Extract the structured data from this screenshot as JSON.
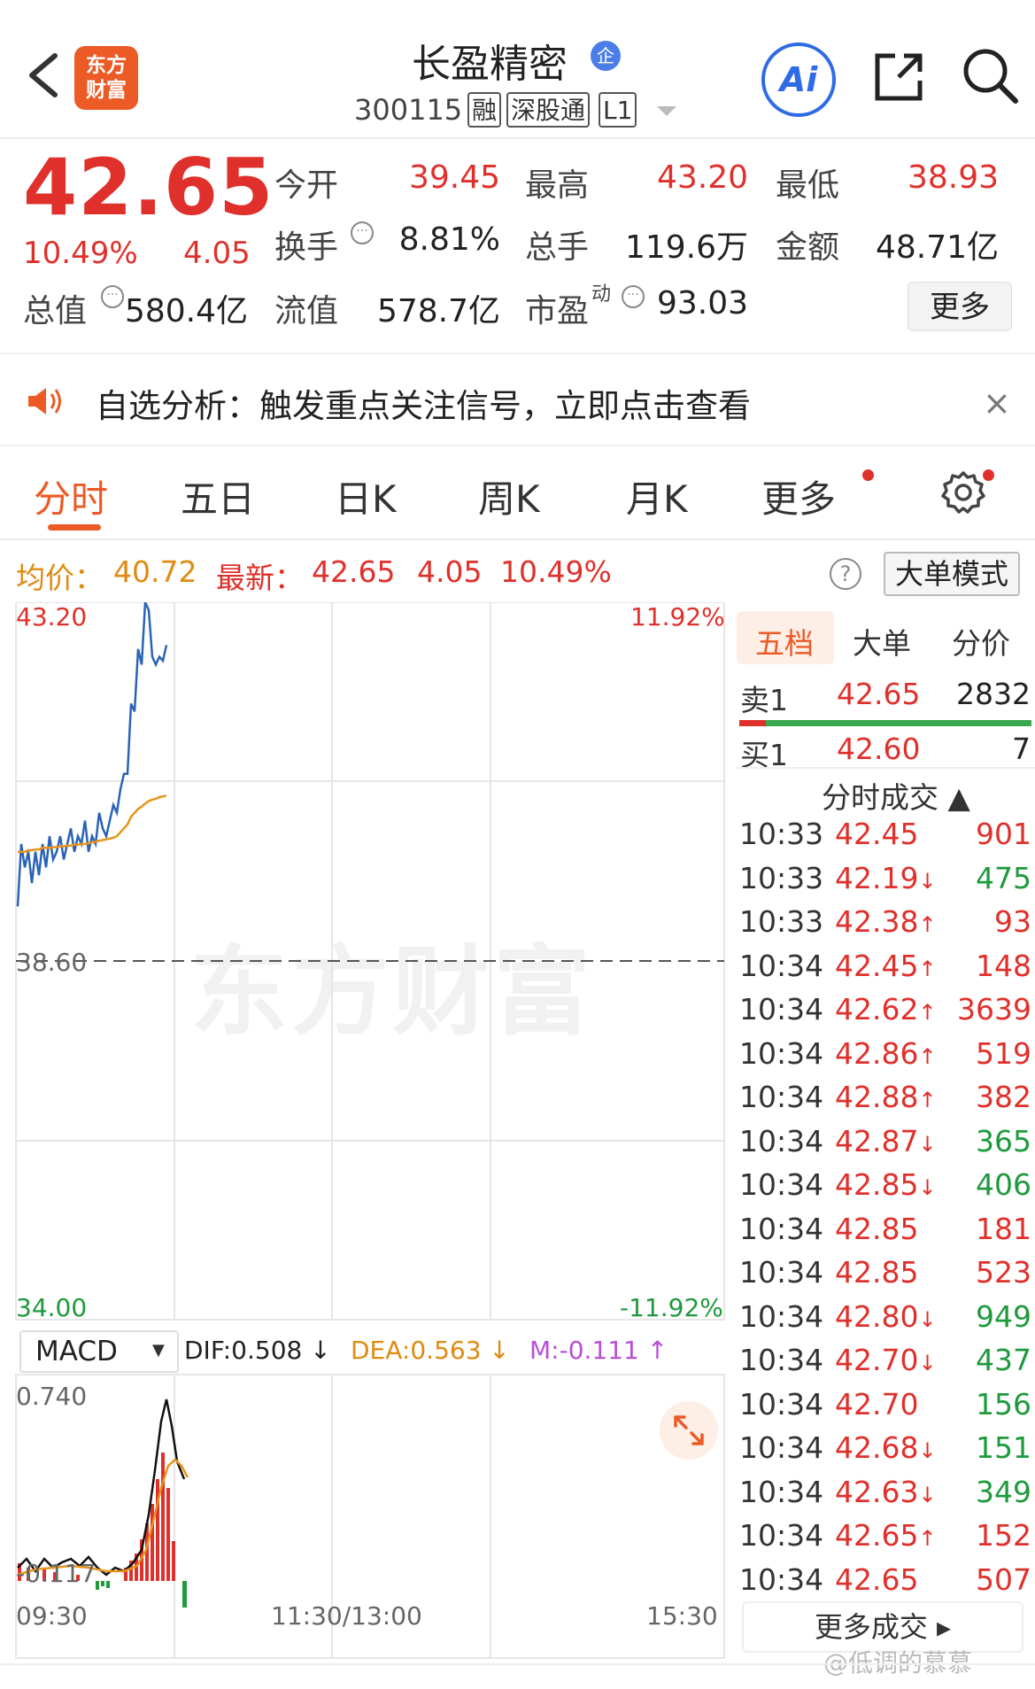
{
  "header": {
    "logo_line1": "东方",
    "logo_line2": "财富",
    "stock_name": "长盈精密",
    "qi_badge": "企",
    "stock_code": "300115",
    "tags": [
      "融",
      "深股通",
      "L1"
    ],
    "ai_label": "Ai"
  },
  "quote": {
    "price": "42.65",
    "change_pct": "10.49%",
    "change": "4.05",
    "open_label": "今开",
    "open": "39.45",
    "high_label": "最高",
    "high": "43.20",
    "low_label": "最低",
    "low": "38.93",
    "turnover_label": "换手",
    "turnover": "8.81%",
    "volume_label": "总手",
    "volume": "119.6万",
    "amount_label": "金额",
    "amount": "48.71亿",
    "mktcap_label": "总值",
    "mktcap": "580.4亿",
    "float_label": "流值",
    "float_cap": "578.7亿",
    "pe_label": "市盈",
    "pe_sup": "动",
    "pe": "93.03",
    "more_label": "更多"
  },
  "notice": {
    "text": "自选分析：触发重点关注信号，立即点击查看",
    "close": "×"
  },
  "tabs": [
    "分时",
    "五日",
    "日K",
    "周K",
    "月K",
    "更多"
  ],
  "price_line": {
    "avg_label": "均价：",
    "avg": "40.72",
    "latest_label": "最新：",
    "latest": "42.65",
    "change": "4.05",
    "pct": "10.49%",
    "help": "?",
    "big_order_mode": "大单模式"
  },
  "chart": {
    "y_max_label": "43.20",
    "y_mid_label": "38.60",
    "y_min_label": "34.00",
    "pct_max_label": "11.92%",
    "pct_min_label": "-11.92%",
    "time_labels": [
      "09:30",
      "11:30/13:00",
      "15:30"
    ],
    "watermark": "东方财富"
  },
  "chart_data": {
    "type": "line",
    "ylim": [
      34.0,
      43.2
    ],
    "reference": 38.6,
    "series": [
      {
        "values": [
          39.3,
          40.1,
          39.8,
          40.0,
          39.6,
          40.0,
          39.7,
          40.1,
          39.8,
          40.2,
          39.9,
          40.0,
          40.2,
          39.9,
          40.1,
          40.3,
          40.0,
          40.2,
          40.1,
          40.4,
          40.0,
          40.2,
          40.1,
          40.5,
          40.3,
          40.2,
          40.4,
          40.6,
          40.5,
          40.8,
          41.0,
          41.0,
          41.9,
          41.8,
          42.6,
          42.4,
          43.2,
          43.1,
          42.5,
          42.4,
          42.5,
          42.45,
          42.65
        ]
      },
      {
        "values": [
          40.0,
          40.0,
          40.0,
          40.02,
          40.02,
          40.03,
          40.03,
          40.05,
          40.05,
          40.05,
          40.06,
          40.06,
          40.07,
          40.07,
          40.08,
          40.08,
          40.09,
          40.09,
          40.1,
          40.1,
          40.11,
          40.12,
          40.13,
          40.14,
          40.15,
          40.16,
          40.17,
          40.18,
          40.2,
          40.25,
          40.3,
          40.35,
          40.45,
          40.5,
          40.55,
          40.58,
          40.62,
          40.65,
          40.67,
          40.68,
          40.7,
          40.71,
          40.72
        ]
      }
    ]
  },
  "macd": {
    "selector": "MACD",
    "dif": "DIF:0.508 ↓",
    "dea": "DEA:0.563 ↓",
    "m": "M:-0.111 ↑",
    "y_max_label": "0.740",
    "y_min_label": "-0.117"
  },
  "order_book": {
    "tabs": [
      "五档",
      "大单",
      "分价"
    ],
    "sell": {
      "label": "卖1",
      "price": "42.65",
      "vol": "2832"
    },
    "buy": {
      "label": "买1",
      "price": "42.60",
      "vol": "7"
    },
    "trades_header": "分时成交 ▲",
    "trades": [
      {
        "time": "10:33",
        "price": "42.45",
        "arrow": "",
        "vol": "901",
        "dir": "red"
      },
      {
        "time": "10:33",
        "price": "42.19",
        "arrow": "↓",
        "vol": "475",
        "dir": "green"
      },
      {
        "time": "10:33",
        "price": "42.38",
        "arrow": "↑",
        "vol": "93",
        "dir": "red"
      },
      {
        "time": "10:34",
        "price": "42.45",
        "arrow": "↑",
        "vol": "148",
        "dir": "red"
      },
      {
        "time": "10:34",
        "price": "42.62",
        "arrow": "↑",
        "vol": "3639",
        "dir": "red"
      },
      {
        "time": "10:34",
        "price": "42.86",
        "arrow": "↑",
        "vol": "519",
        "dir": "red"
      },
      {
        "time": "10:34",
        "price": "42.88",
        "arrow": "↑",
        "vol": "382",
        "dir": "red"
      },
      {
        "time": "10:34",
        "price": "42.87",
        "arrow": "↓",
        "vol": "365",
        "dir": "green"
      },
      {
        "time": "10:34",
        "price": "42.85",
        "arrow": "↓",
        "vol": "406",
        "dir": "green"
      },
      {
        "time": "10:34",
        "price": "42.85",
        "arrow": "",
        "vol": "181",
        "dir": "red"
      },
      {
        "time": "10:34",
        "price": "42.85",
        "arrow": "",
        "vol": "523",
        "dir": "red"
      },
      {
        "time": "10:34",
        "price": "42.80",
        "arrow": "↓",
        "vol": "949",
        "dir": "green"
      },
      {
        "time": "10:34",
        "price": "42.70",
        "arrow": "↓",
        "vol": "437",
        "dir": "green"
      },
      {
        "time": "10:34",
        "price": "42.70",
        "arrow": "",
        "vol": "156",
        "dir": "green"
      },
      {
        "time": "10:34",
        "price": "42.68",
        "arrow": "↓",
        "vol": "151",
        "dir": "green"
      },
      {
        "time": "10:34",
        "price": "42.63",
        "arrow": "↓",
        "vol": "349",
        "dir": "green"
      },
      {
        "time": "10:34",
        "price": "42.65",
        "arrow": "↑",
        "vol": "152",
        "dir": "red"
      },
      {
        "time": "10:34",
        "price": "42.65",
        "arrow": "",
        "vol": "507",
        "dir": "red"
      }
    ],
    "more_trades": "更多成交 ▸"
  },
  "watermark_user": "@低调的慕慕",
  "colors": {
    "up": "#e0302b",
    "down": "#1e9a3c",
    "accent": "#ec5a25",
    "price_line": "#2b63b5",
    "avg_line": "#e8941a"
  }
}
